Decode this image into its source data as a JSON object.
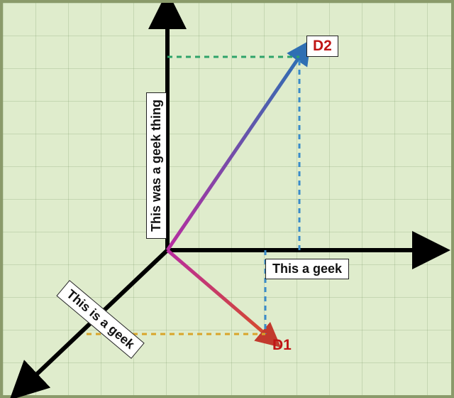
{
  "axes": {
    "y_label": "This was a geek thing",
    "x_label": "This a geek",
    "z_label": "This is a geek"
  },
  "points": {
    "d2": "D2",
    "d1": "D1"
  },
  "chart_data": {
    "type": "scatter",
    "title": "",
    "axes": [
      "This a geek",
      "This was a geek thing",
      "This is a geek"
    ],
    "series": [
      {
        "name": "D2",
        "coords": {
          "x": 1,
          "y": 1,
          "z": 0
        }
      },
      {
        "name": "D1",
        "coords": {
          "x": 1,
          "y": 0,
          "z": 1
        }
      }
    ]
  }
}
